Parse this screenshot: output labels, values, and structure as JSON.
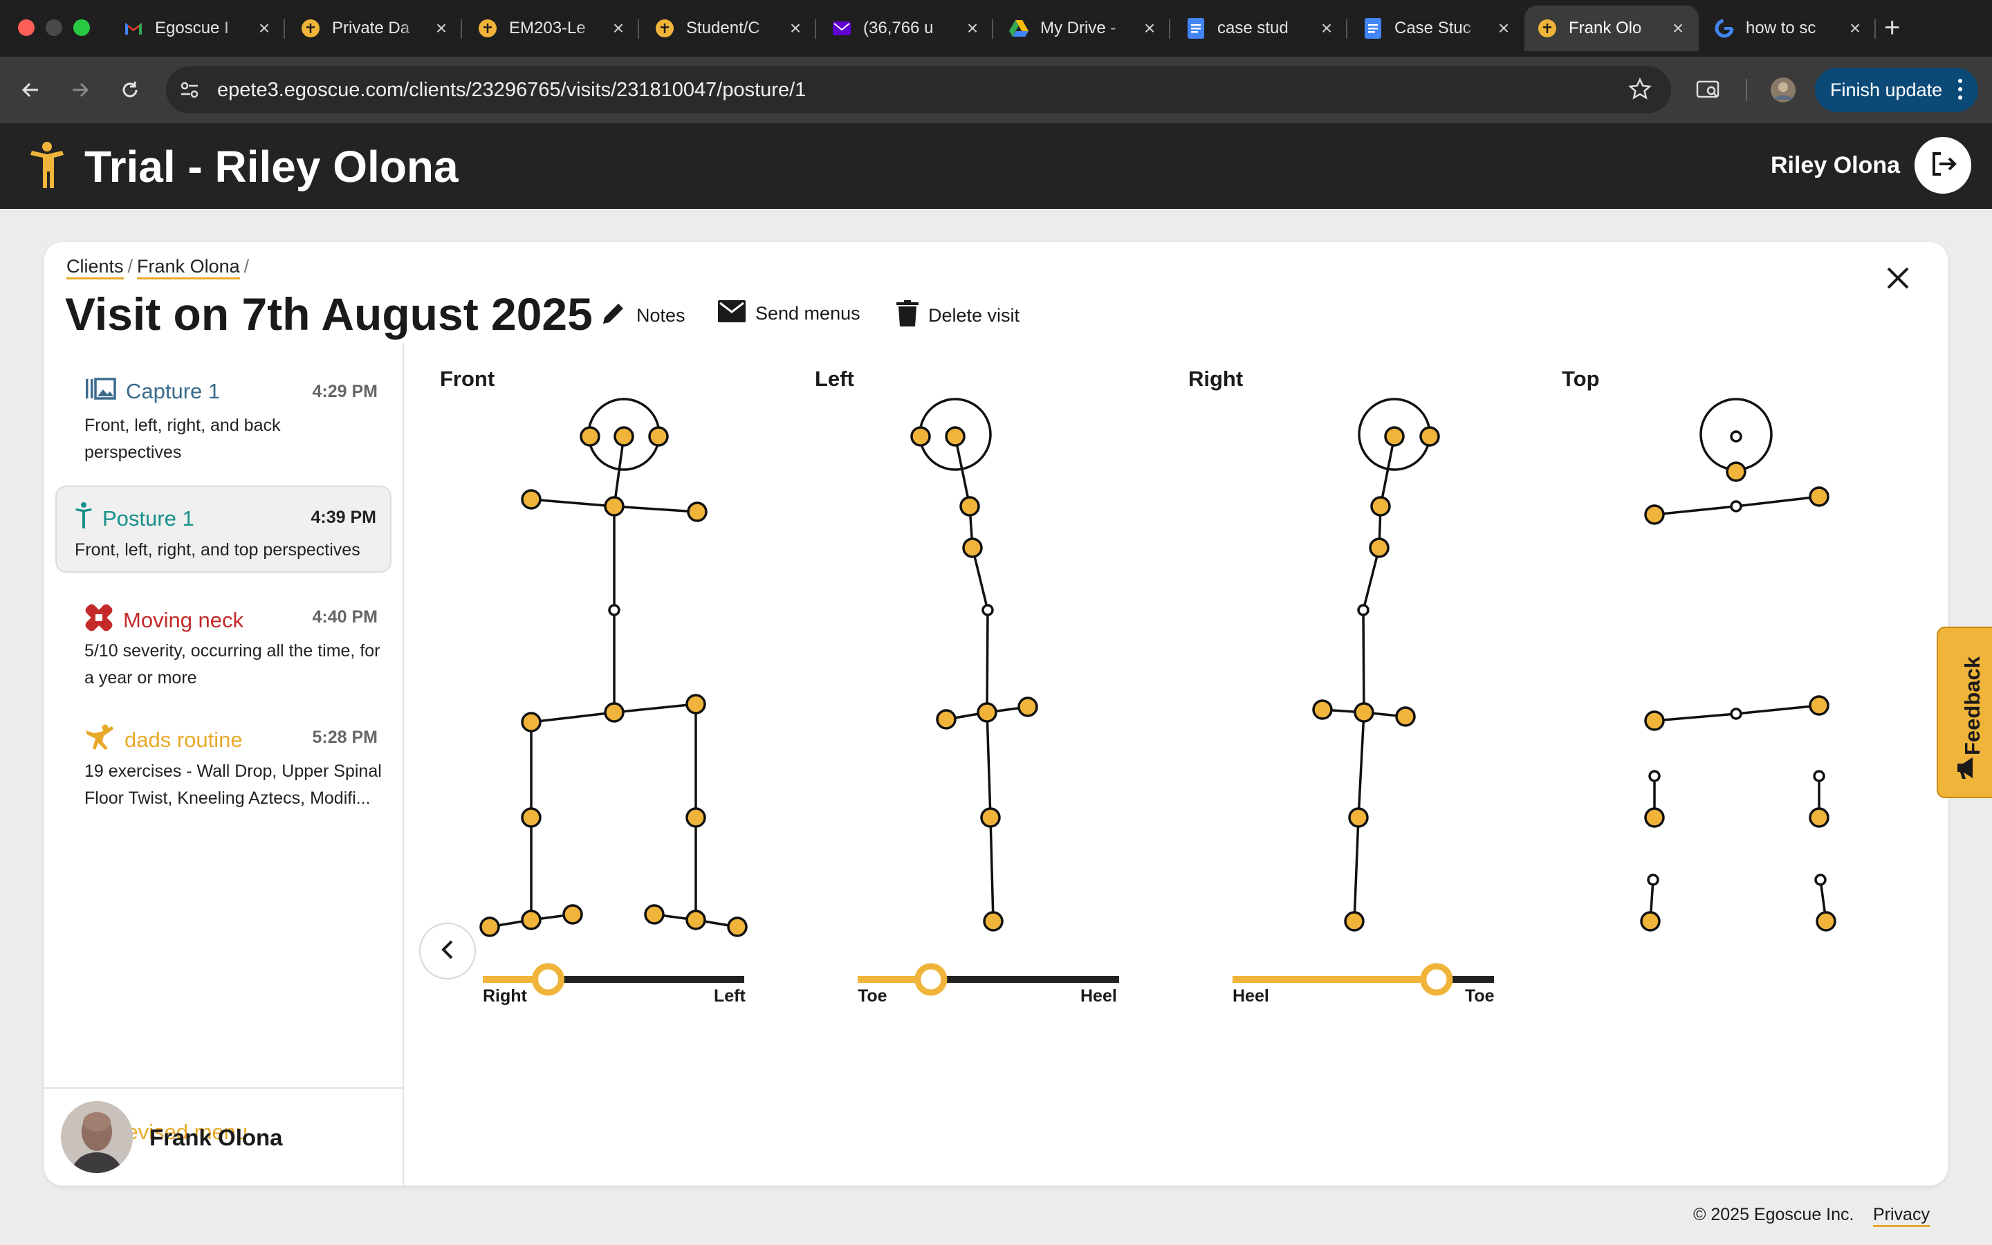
{
  "browser": {
    "tabs": [
      {
        "title": "Egoscue I",
        "favicon": "gmail-icon"
      },
      {
        "title": "Private Da",
        "favicon": "egoscue-icon"
      },
      {
        "title": "EM203-Le",
        "favicon": "egoscue-icon"
      },
      {
        "title": "Student/C",
        "favicon": "egoscue-icon"
      },
      {
        "title": "(36,766 u",
        "favicon": "yahoo-mail-icon"
      },
      {
        "title": "My Drive -",
        "favicon": "drive-icon"
      },
      {
        "title": "case stud",
        "favicon": "docs-icon"
      },
      {
        "title": "Case Stuc",
        "favicon": "docs-icon"
      },
      {
        "title": "Frank Olo",
        "favicon": "egoscue-icon",
        "active": true
      },
      {
        "title": "how to sc",
        "favicon": "google-icon"
      }
    ],
    "url": "epete3.egoscue.com/clients/23296765/visits/231810047/posture/1",
    "finish_update_label": "Finish update"
  },
  "header": {
    "app_title": "Trial - Riley Olona",
    "user_name": "Riley Olona"
  },
  "breadcrumb": {
    "items": [
      "Clients",
      "Frank Olona"
    ]
  },
  "visit": {
    "title": "Visit on 7th August 2025",
    "actions": {
      "notes": "Notes",
      "send_menus": "Send menus",
      "delete_visit": "Delete visit"
    }
  },
  "sidebar": {
    "items": [
      {
        "title": "Capture 1",
        "time": "4:29 PM",
        "description": "Front, left, right, and back perspectives",
        "color": "#3a6b8c",
        "icon": "gallery-icon"
      },
      {
        "title": "Posture 1",
        "time": "4:39 PM",
        "description": "Front, left, right, and top perspectives",
        "color": "#17908a",
        "icon": "posture-figure-icon",
        "selected": true
      },
      {
        "title": "Moving neck",
        "time": "4:40 PM",
        "description": "5/10 severity, occurring all the time, for a year or more",
        "color": "#c42a2a",
        "icon": "bandage-icon"
      },
      {
        "title": "dads routine",
        "time": "5:28 PM",
        "description": "19 exercises - Wall Drop, Upper Spinal Floor Twist, Kneeling Aztecs, Modifi...",
        "color": "#e8a92a",
        "icon": "exercise-figure-icon"
      }
    ],
    "revised_menu_label": "Revised menu",
    "client_name": "Frank Olona"
  },
  "posture": {
    "views": [
      {
        "label": "Front",
        "slider": {
          "left_label": "Right",
          "right_label": "Left",
          "value": 0.25
        }
      },
      {
        "label": "Left",
        "slider": {
          "left_label": "Toe",
          "right_label": "Heel",
          "value": 0.28
        }
      },
      {
        "label": "Right",
        "slider": {
          "left_label": "Heel",
          "right_label": "Toe",
          "value": 0.78
        }
      },
      {
        "label": "Top"
      }
    ],
    "accent_color": "#f0b43a"
  },
  "feedback_label": "Feedback",
  "footer": {
    "copyright": "© 2025 Egoscue Inc.",
    "privacy": "Privacy"
  }
}
